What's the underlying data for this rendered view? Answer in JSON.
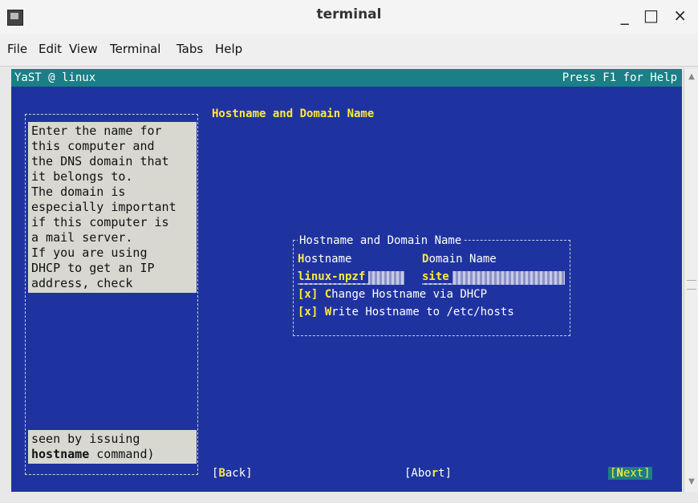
{
  "window": {
    "title": "terminal",
    "controls": "_ □ ×"
  },
  "menu": {
    "file": "File",
    "edit": "Edit",
    "view": "View",
    "terminal": "Terminal",
    "tabs": "Tabs",
    "help": "Help"
  },
  "term_header": {
    "left": "YaST @ linux",
    "right": "Press F1 for Help"
  },
  "screen_title": "Hostname and Domain Name",
  "help_text": {
    "lines": [
      "Enter the name for",
      "this computer and",
      "the DNS domain that",
      "it belongs to.",
      "",
      "The domain is",
      "especially important",
      "if this computer is",
      "a mail server.",
      "",
      "If you are using",
      "DHCP to get an IP",
      "address, check"
    ],
    "tail_line1": "seen by issuing",
    "tail_hot": "hostname",
    "tail_rest": " command)"
  },
  "frame": {
    "label": "Hostname and Domain Name",
    "hostname_hot": "H",
    "hostname_rest": "ostname",
    "domain_hot": "D",
    "domain_rest": "omain Name",
    "hostname_value": "linux-npzf",
    "domain_value": "site",
    "check1": {
      "box": "[x]",
      "hot": "C",
      "rest": "hange Hostname via DHCP"
    },
    "check2": {
      "box": "[x]",
      "hot": "W",
      "rest": "rite Hostname to /etc/hosts"
    }
  },
  "buttons": {
    "back_open": "[",
    "back_hot": "B",
    "back_rest": "ack]",
    "abort_text": "[Abo",
    "abort_hot": "r",
    "abort_rest": "t]",
    "next_open": "[",
    "next_hot": "N",
    "next_rest": "ext]"
  },
  "colors": {
    "terminal_bg": "#1f33a0",
    "accent": "#ffe93a",
    "header_bg": "#1a7f86"
  }
}
